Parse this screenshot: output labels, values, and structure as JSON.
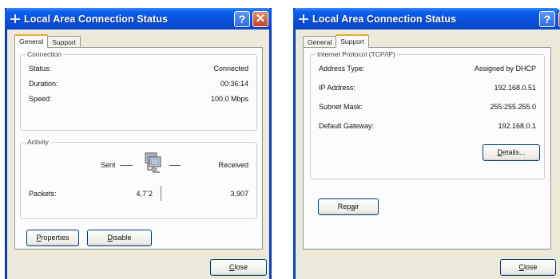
{
  "left_window": {
    "title": "Local Area Connection Status",
    "help_glyph": "?",
    "close_glyph": "✕",
    "tabs": [
      "General",
      "Support"
    ],
    "connection": {
      "group_label": "Connection",
      "rows": [
        {
          "label": "Status:",
          "value": "Connected"
        },
        {
          "label": "Duration:",
          "value": "00:36:14"
        },
        {
          "label": "Speed:",
          "value": "100.0 Mbps"
        }
      ]
    },
    "activity": {
      "group_label": "Activity",
      "sent_label": "Sent",
      "received_label": "Received",
      "packets_label": "Packets:",
      "packets_sent": "4,7ˆ2",
      "packets_received": "3,907"
    },
    "properties_button": {
      "mnemonic": "P",
      "rest": "roperties"
    },
    "disable_button": {
      "mnemonic": "D",
      "rest": "isable"
    },
    "close_button": {
      "mnemonic": "C",
      "rest": "lose"
    }
  },
  "right_window": {
    "title": "Local Area Connection Status",
    "help_glyph": "?",
    "close_glyph": "✕",
    "tabs": [
      "General",
      "Support"
    ],
    "tcpip": {
      "group_label": "Internet Protocol (TCP/IP)",
      "rows": [
        {
          "label": "Address Type:",
          "value": "Assigned by DHCP"
        },
        {
          "label": "IP Address:",
          "value": "192.168.0.51"
        },
        {
          "label": "Subnet Mask:",
          "value": "255.255.255.0"
        },
        {
          "label": "Default Gateway:",
          "value": "192.168.0.1"
        }
      ]
    },
    "details_button": {
      "mnemonic": "D",
      "rest": "etails..."
    },
    "repair_button": {
      "before": "Rep",
      "mnemonic": "a",
      "rest": "ir"
    },
    "close_button": {
      "mnemonic": "C",
      "rest": "lose"
    }
  },
  "colors": {
    "titlebar_blue": "#0a5ff0",
    "window_face": "#ece9d8",
    "tab_highlight": "#f0a830",
    "close_red": "#c8402a"
  },
  "icons": [
    "connection-icon",
    "help-icon",
    "close-icon",
    "computer-activity-icon"
  ]
}
